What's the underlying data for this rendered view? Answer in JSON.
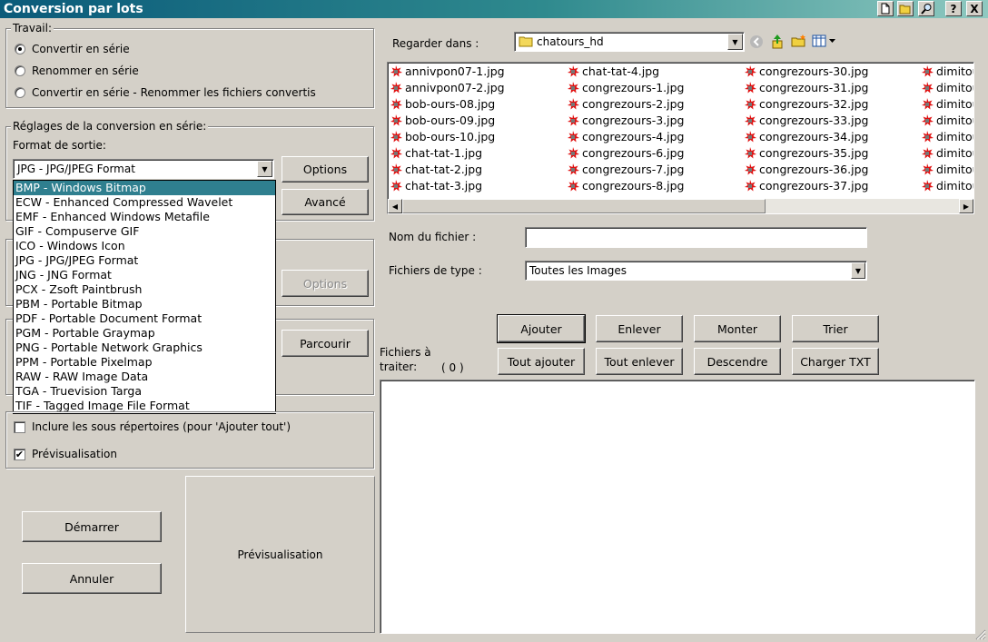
{
  "window": {
    "title": "Conversion par lots",
    "help": "?",
    "close": "X"
  },
  "travail": {
    "legend": "Travail:",
    "options": [
      {
        "label": "Convertir en série",
        "checked": true
      },
      {
        "label": "Renommer en série",
        "checked": false
      },
      {
        "label": "Convertir en série - Renommer les fichiers convertis",
        "checked": false
      }
    ]
  },
  "reglages": {
    "legend": "Réglages de la conversion en série:",
    "format_label": "Format de sortie:",
    "format_value": "JPG - JPG/JPEG Format",
    "options_button": "Options",
    "advanced_button": "Avancé"
  },
  "format_list": [
    "BMP - Windows Bitmap",
    "ECW - Enhanced Compressed Wavelet",
    "EMF - Enhanced Windows Metafile",
    "GIF - Compuserve GIF",
    "ICO - Windows Icon",
    "JPG - JPG/JPEG Format",
    "JNG - JNG Format",
    "PCX - Zsoft Paintbrush",
    "PBM - Portable Bitmap",
    "PDF - Portable Document Format",
    "PGM - Portable Graymap",
    "PNG - Portable Network Graphics",
    "PPM - Portable Pixelmap",
    "RAW - RAW Image Data",
    "TGA - Truevision Targa",
    "TIF - Tagged Image File Format"
  ],
  "format_list_selected": 0,
  "options_disabled_button": "Options",
  "browse_button": "Parcourir",
  "checkboxes": {
    "subdirs": {
      "label": "Inclure les sous répertoires (pour 'Ajouter tout')",
      "checked": false
    },
    "preview": {
      "label": "Prévisualisation",
      "checked": true
    }
  },
  "actions": {
    "start": "Démarrer",
    "cancel": "Annuler"
  },
  "preview_panel": {
    "label": "Prévisualisation"
  },
  "browser": {
    "look_in_label": "Regarder dans :",
    "folder": "chatours_hd",
    "files_col1": [
      "annivpon07-1.jpg",
      "annivpon07-2.jpg",
      "bob-ours-08.jpg",
      "bob-ours-09.jpg",
      "bob-ours-10.jpg",
      "chat-tat-1.jpg",
      "chat-tat-2.jpg",
      "chat-tat-3.jpg"
    ],
    "files_col2": [
      "chat-tat-4.jpg",
      "congrezours-1.jpg",
      "congrezours-2.jpg",
      "congrezours-3.jpg",
      "congrezours-4.jpg",
      "congrezours-6.jpg",
      "congrezours-7.jpg",
      "congrezours-8.jpg"
    ],
    "files_col3": [
      "congrezours-30.jpg",
      "congrezours-31.jpg",
      "congrezours-32.jpg",
      "congrezours-33.jpg",
      "congrezours-34.jpg",
      "congrezours-35.jpg",
      "congrezours-36.jpg",
      "congrezours-37.jpg"
    ],
    "files_col4": [
      "dimitou",
      "dimitou",
      "dimitou",
      "dimitou",
      "dimitou",
      "dimitou",
      "dimitou",
      "dimitou"
    ],
    "filename_label": "Nom du fichier :",
    "filename_value": "",
    "filetype_label": "Fichiers de type :",
    "filetype_value": "Toutes les Images"
  },
  "queue": {
    "buttons_row1": [
      "Ajouter",
      "Enlever",
      "Monter",
      "Trier"
    ],
    "buttons_row2": [
      "Tout ajouter",
      "Tout enlever",
      "Descendre",
      "Charger TXT"
    ],
    "label": "Fichiers à traiter:",
    "label_line1": "Fichiers à",
    "label_line2": "traiter:",
    "count": "( 0 )"
  },
  "colors": {
    "face": "#d4d0c8",
    "selection": "#2f7f8f",
    "file_icon": "#e01010"
  },
  "icons": [
    "new-doc-icon",
    "folder-open-icon",
    "magnifier-icon",
    "help-icon",
    "close-icon",
    "folder-icon",
    "back-icon",
    "up-folder-icon",
    "new-folder-icon",
    "view-menu-icon",
    "image-file-icon"
  ]
}
